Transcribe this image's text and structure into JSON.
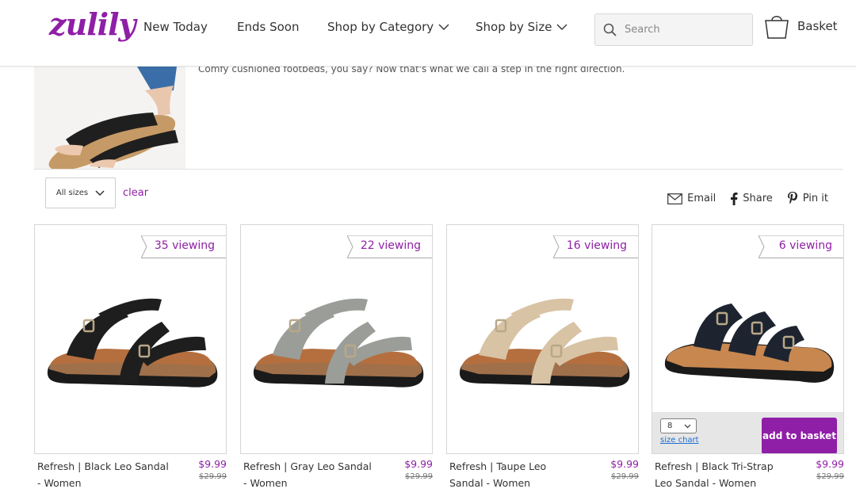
{
  "header": {
    "logo": "zulily",
    "nav": [
      "New Today",
      "Ends Soon",
      "Shop by Category",
      "Shop by Size"
    ],
    "search_placeholder": "Search",
    "basket_label": "Basket"
  },
  "event": {
    "description": "Comfy cushioned footbeds, you say? Now that's what we call a step in the right direction."
  },
  "filters": {
    "size_label": "All sizes",
    "clear_label": "clear"
  },
  "share": {
    "email": "Email",
    "share": "Share",
    "pin": "Pin it"
  },
  "products": [
    {
      "viewing": "35 viewing",
      "name": "Refresh | Black Leo Sandal - Women",
      "price": "$9.99",
      "original_price": "$29.99",
      "color": "#1e1e1e"
    },
    {
      "viewing": "22 viewing",
      "name": "Refresh | Gray Leo Sandal - Women",
      "price": "$9.99",
      "original_price": "$29.99",
      "color": "#9a9d98"
    },
    {
      "viewing": "16 viewing",
      "name": "Refresh | Taupe Leo Sandal - Women",
      "price": "$9.99",
      "original_price": "$29.99",
      "color": "#d8c3a5"
    },
    {
      "viewing": "6 viewing",
      "name": "Refresh | Black Tri-Strap Leo Sandal - Women",
      "price": "$9.99",
      "original_price": "$29.99",
      "color": "#1d2430"
    }
  ],
  "hover_card": {
    "selected_size": "8",
    "size_chart_label": "size chart",
    "add_to_basket_label": "add to basket"
  },
  "colors": {
    "brand": "#8f1fa6",
    "link": "#1a6fd1"
  }
}
